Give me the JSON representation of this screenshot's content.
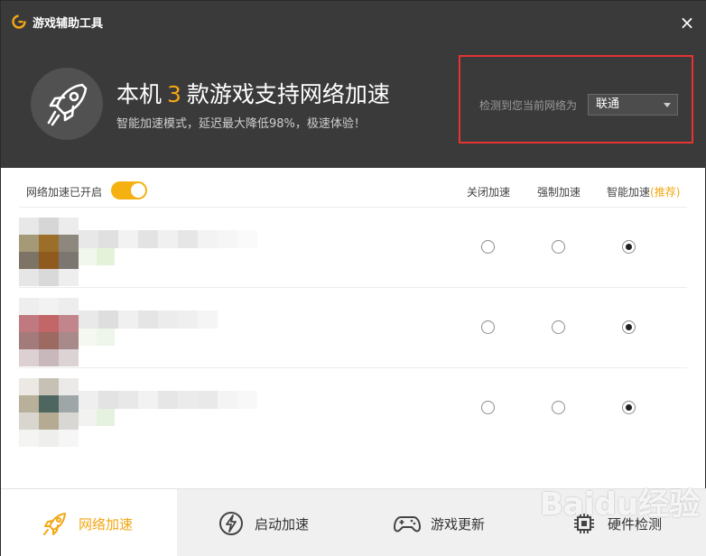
{
  "window": {
    "title": "游戏辅助工具",
    "close_label": "×"
  },
  "header": {
    "headline_prefix": "本机",
    "game_count": "3",
    "headline_suffix": "款游戏支持网络加速",
    "subtitle": "智能加速模式，延迟最大降低98%，极速体验！",
    "detect_label": "检测到您当前网络为",
    "isp_selected": "联通"
  },
  "toolbar": {
    "toggle_label": "网络加速已开启",
    "toggle_on": true,
    "columns": {
      "off": "关闭加速",
      "force": "强制加速",
      "smart": "智能加速",
      "recommended": "(推荐)"
    }
  },
  "games": [
    {
      "selected_mode": "smart"
    },
    {
      "selected_mode": "smart"
    },
    {
      "selected_mode": "smart"
    }
  ],
  "footer": {
    "tabs": [
      {
        "label": "网络加速",
        "icon": "rocket-icon",
        "active": true
      },
      {
        "label": "启动加速",
        "icon": "lightning-icon",
        "active": false
      },
      {
        "label": "游戏更新",
        "icon": "gamepad-icon",
        "active": false
      },
      {
        "label": "硬件检测",
        "icon": "hardware-icon",
        "active": false
      }
    ]
  },
  "watermark": "Baidu经验",
  "colors": {
    "accent": "#f3a713",
    "header_bg": "#3b3a3a",
    "highlight_border": "#e53232"
  }
}
